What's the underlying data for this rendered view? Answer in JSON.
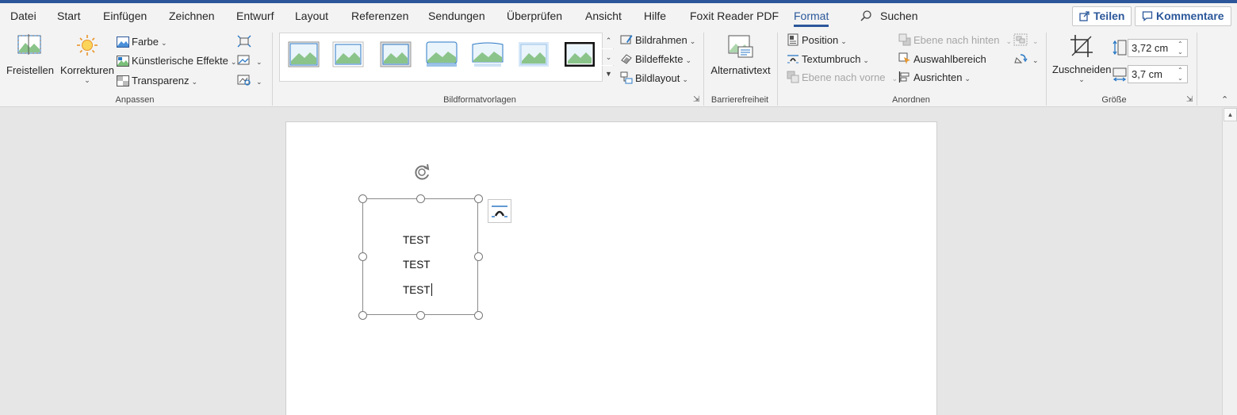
{
  "menu": {
    "tabs": [
      "Datei",
      "Start",
      "Einfügen",
      "Zeichnen",
      "Entwurf",
      "Layout",
      "Referenzen",
      "Sendungen",
      "Überprüfen",
      "Ansicht",
      "Hilfe",
      "Foxit Reader PDF",
      "Format"
    ],
    "active_tab": "Format",
    "search_label": "Suchen",
    "share_label": "Teilen",
    "comments_label": "Kommentare"
  },
  "ribbon": {
    "anpassen": {
      "group_label": "Anpassen",
      "remove_bg": "Freistellen",
      "corrections": "Korrekturen",
      "color": "Farbe",
      "artistic": "Künstlerische Effekte",
      "transparency": "Transparenz"
    },
    "styles": {
      "group_label": "Bildformatvorlagen",
      "border": "Bildrahmen",
      "effects": "Bildeffekte",
      "layout": "Bildlayout"
    },
    "accessibility": {
      "group_label": "Barrierefreiheit",
      "alt_text": "Alternativtext"
    },
    "arrange": {
      "group_label": "Anordnen",
      "position": "Position",
      "wrap": "Textumbruch",
      "forward": "Ebene nach vorne",
      "backward": "Ebene nach hinten",
      "selection_pane": "Auswahlbereich",
      "align": "Ausrichten"
    },
    "size": {
      "group_label": "Größe",
      "crop": "Zuschneiden",
      "height": "3,72 cm",
      "width": "3,7 cm"
    }
  },
  "document": {
    "textbox_lines": [
      "TEST",
      "TEST",
      "TEST"
    ]
  },
  "colors": {
    "accent": "#2b579a",
    "ribbon_bg": "#f3f3f3",
    "workspace_bg": "#e6e6e6"
  }
}
